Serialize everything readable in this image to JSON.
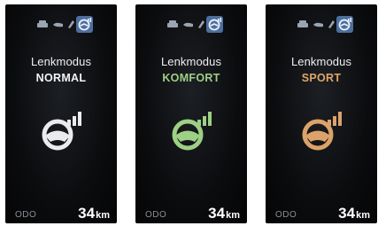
{
  "screens": [
    {
      "title": "Lenkmodus",
      "mode": "NORMAL",
      "mode_color": "#f2f3f5",
      "icon_color": "#e9ebee",
      "odo_label": "ODO",
      "distance": "34",
      "unit": "km"
    },
    {
      "title": "Lenkmodus",
      "mode": "KOMFORT",
      "mode_color": "#9fcf86",
      "icon_color": "#9dd085",
      "odo_label": "ODO",
      "distance": "34",
      "unit": "km"
    },
    {
      "title": "Lenkmodus",
      "mode": "SPORT",
      "mode_color": "#e0a567",
      "icon_color": "#dca26a",
      "odo_label": "ODO",
      "distance": "34",
      "unit": "km"
    }
  ],
  "status_icons": [
    "car-icon",
    "lamp-icon",
    "wrench-icon",
    "steering-wheel-icon"
  ],
  "colors": {
    "status_icon": "#9aa4b2",
    "status_active_bg": "#4d6fa0"
  }
}
